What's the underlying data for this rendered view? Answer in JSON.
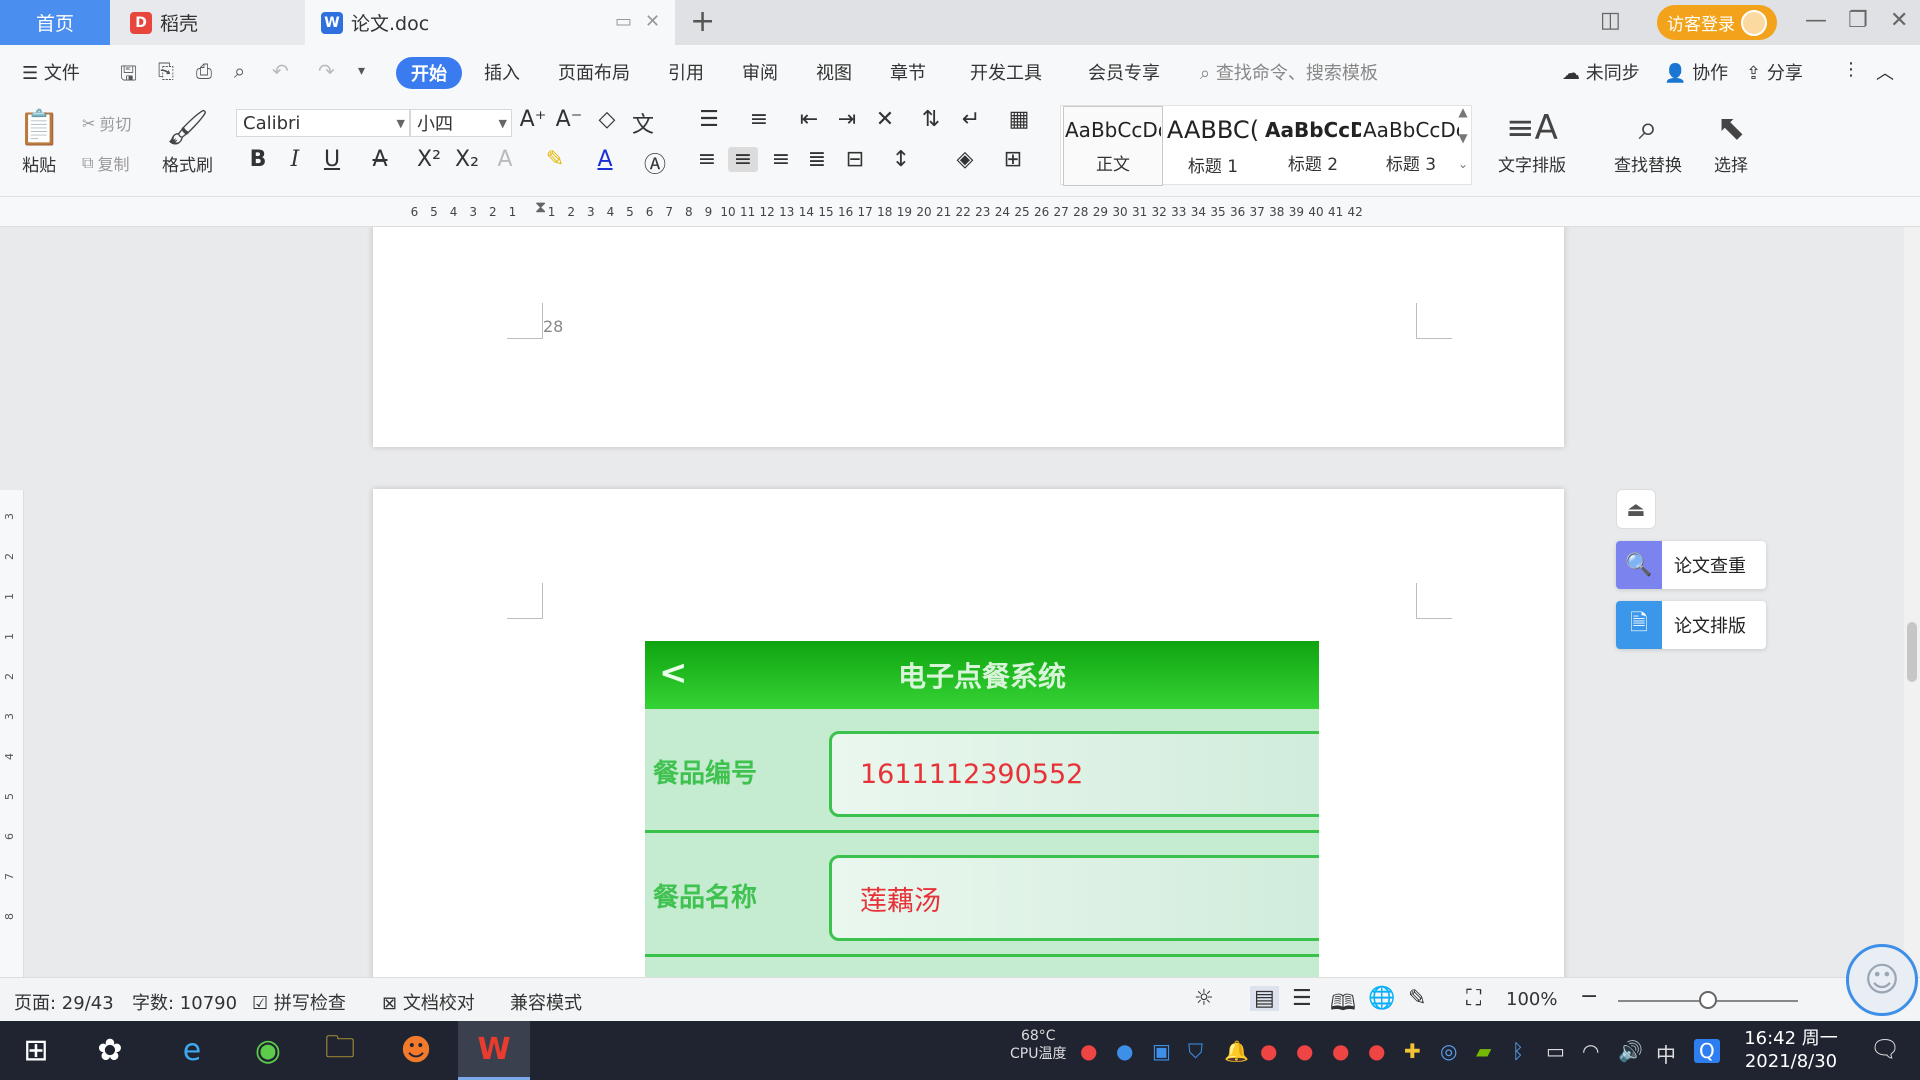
{
  "tabs": {
    "home": "首页",
    "daoke": "稻壳",
    "doc": "论文.doc"
  },
  "titlebar": {
    "login": "访客登录"
  },
  "menu": {
    "file": "文件",
    "items": [
      "开始",
      "插入",
      "页面布局",
      "引用",
      "审阅",
      "视图",
      "章节",
      "开发工具",
      "会员专享"
    ],
    "search_placeholder": "查找命令、搜索模板",
    "unsynced": "未同步",
    "collab": "协作",
    "share": "分享"
  },
  "ribbon": {
    "paste": "粘贴",
    "cut": "剪切",
    "copy": "复制",
    "format_painter": "格式刷",
    "font_name": "Calibri",
    "font_size": "小四",
    "styles": [
      {
        "sample": "AaBbCcDd",
        "label": "正文"
      },
      {
        "sample": "AABBC(",
        "label": "标题 1"
      },
      {
        "sample": "AaBbCcD",
        "label": "标题 2"
      },
      {
        "sample": "AaBbCcDc",
        "label": "标题 3"
      }
    ],
    "text_layout": "文字排版",
    "find_replace": "查找替换",
    "select": "选择"
  },
  "ruler": {
    "left_ticks": [
      "6",
      "5",
      "4",
      "3",
      "2",
      "1"
    ],
    "right_ticks": [
      "1",
      "2",
      "3",
      "4",
      "5",
      "6",
      "7",
      "8",
      "9",
      "10",
      "11",
      "12",
      "13",
      "14",
      "15",
      "16",
      "17",
      "18",
      "19",
      "20",
      "21",
      "22",
      "23",
      "24",
      "25",
      "26",
      "27",
      "28",
      "29",
      "30",
      "31",
      "32",
      "33",
      "34",
      "35",
      "36",
      "37",
      "38",
      "39",
      "40",
      "41",
      "42"
    ],
    "vertical_ticks": [
      "3",
      "2",
      "1",
      "1",
      "2",
      "3",
      "4",
      "5",
      "6",
      "7",
      "8"
    ]
  },
  "document": {
    "prev_page_number": "28",
    "embedded_screenshot": {
      "header": "电子点餐系统",
      "back": "<",
      "rows": [
        {
          "label": "餐品编号",
          "value": "1611112390552"
        },
        {
          "label": "餐品名称",
          "value": "莲藕汤"
        }
      ]
    }
  },
  "side_panel": {
    "check": "论文查重",
    "layout": "论文排版"
  },
  "status": {
    "page": "页面: 29/43",
    "words": "字数: 10790",
    "spell": "拼写检查",
    "proof": "文档校对",
    "compat": "兼容模式",
    "zoom": "100%",
    "zoom_level": 0.5
  },
  "taskbar": {
    "cpu_temp": "68°C",
    "cpu_label": "CPU温度",
    "ime": "中",
    "time": "16:42 周一",
    "date": "2021/8/30"
  },
  "colors": {
    "accent": "#3a7bef",
    "home_tab": "#4a8ef0",
    "login": "#f2a31b",
    "app_green": "#19b019",
    "field_red": "#e8323a"
  }
}
